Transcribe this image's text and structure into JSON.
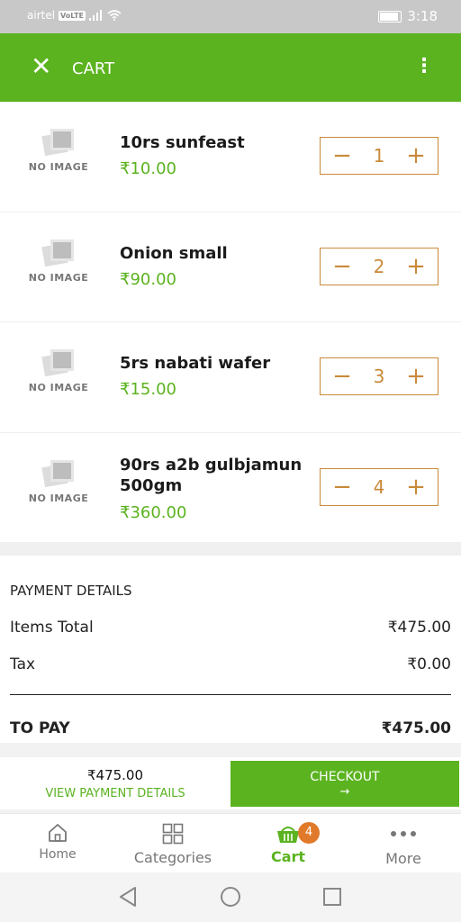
{
  "status_bar": {
    "carrier": "airtel",
    "volte": "VoLTE",
    "time": "3:18"
  },
  "appbar": {
    "title": "CART",
    "close_icon": "close-icon",
    "menu_icon": "more-vert-icon"
  },
  "cart": {
    "no_image_label": "NO IMAGE",
    "items": [
      {
        "name": "10rs sunfeast",
        "price": "₹10.00",
        "qty": "1"
      },
      {
        "name": "Onion small",
        "price": "₹90.00",
        "qty": "2"
      },
      {
        "name": "5rs nabati wafer",
        "price": "₹15.00",
        "qty": "3"
      },
      {
        "name": "90rs a2b gulbjamun 500gm",
        "price": "₹360.00",
        "qty": "4"
      }
    ]
  },
  "payment": {
    "header": "PAYMENT DETAILS",
    "items_total_label": "Items Total",
    "items_total_value": "₹475.00",
    "tax_label": "Tax",
    "tax_value": "₹0.00",
    "to_pay_label": "TO PAY",
    "to_pay_value": "₹475.00"
  },
  "checkout_bar": {
    "amount": "₹475.00",
    "view_details": "VIEW PAYMENT DETAILS",
    "checkout_label": "CHECKOUT",
    "checkout_arrow": "→"
  },
  "tabs": [
    {
      "label": "Home",
      "icon": "home-icon"
    },
    {
      "label": "Categories",
      "icon": "grid-icon"
    },
    {
      "label": "Cart",
      "icon": "basket-icon",
      "active": true,
      "badge": "4"
    },
    {
      "label": "More",
      "icon": "more-horiz-icon"
    }
  ],
  "colors": {
    "primary": "#5bb320",
    "accent": "#c98a3a",
    "badge": "#e07a2a"
  }
}
